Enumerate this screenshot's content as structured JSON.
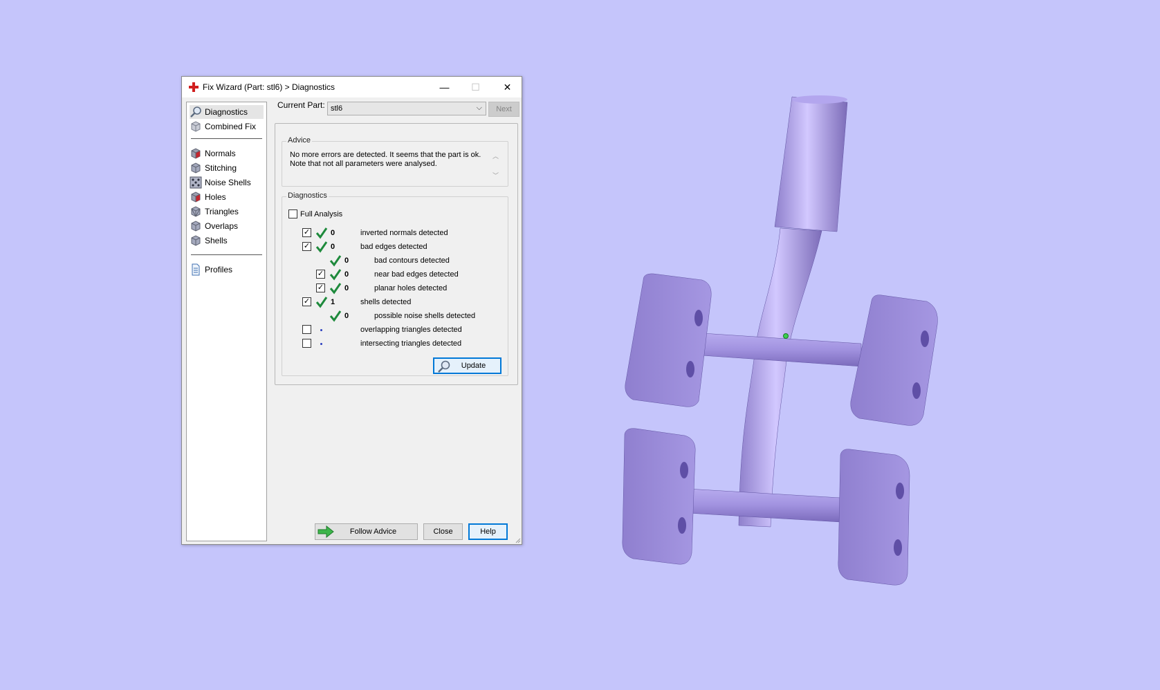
{
  "window": {
    "title": "Fix Wizard (Part: stl6) > Diagnostics",
    "controls": {
      "minimize": "—",
      "maximize": "☐",
      "close": "✕"
    }
  },
  "nav": {
    "items": [
      {
        "label": "Diagnostics",
        "icon": "magnifier-icon"
      },
      {
        "label": "Combined Fix",
        "icon": "cube-icon"
      },
      {
        "label": "Normals",
        "icon": "cube-red-icon"
      },
      {
        "label": "Stitching",
        "icon": "cube-icon"
      },
      {
        "label": "Noise Shells",
        "icon": "dice-icon"
      },
      {
        "label": "Holes",
        "icon": "cube-red-icon"
      },
      {
        "label": "Triangles",
        "icon": "cube-icon"
      },
      {
        "label": "Overlaps",
        "icon": "cube-icon"
      },
      {
        "label": "Shells",
        "icon": "cube-icon"
      },
      {
        "label": "Profiles",
        "icon": "document-icon"
      }
    ]
  },
  "current_part": {
    "label": "Current Part:",
    "value": "stl6",
    "next_label": "Next"
  },
  "advice": {
    "title": "Advice",
    "line1": "No more errors are detected. It seems that the part is ok.",
    "line2": "Note that not all parameters were analysed."
  },
  "diagnostics": {
    "title": "Diagnostics",
    "full_analysis_label": "Full Analysis",
    "rows": [
      {
        "checked": true,
        "has_checkbox": true,
        "status": "ok",
        "count": "0",
        "label": "inverted normals detected"
      },
      {
        "checked": true,
        "has_checkbox": true,
        "status": "ok",
        "count": "0",
        "label": "bad edges detected"
      },
      {
        "checked": false,
        "has_checkbox": false,
        "status": "ok",
        "count": "0",
        "label": "bad contours detected"
      },
      {
        "checked": true,
        "has_checkbox": true,
        "status": "ok",
        "count": "0",
        "label": "near bad edges detected"
      },
      {
        "checked": true,
        "has_checkbox": true,
        "status": "ok",
        "count": "0",
        "label": "planar holes detected"
      },
      {
        "checked": true,
        "has_checkbox": true,
        "status": "ok",
        "count": "1",
        "label": "shells detected"
      },
      {
        "checked": false,
        "has_checkbox": false,
        "status": "ok",
        "count": "0",
        "label": "possible noise shells detected"
      },
      {
        "checked": false,
        "has_checkbox": true,
        "status": "pending",
        "count": "",
        "label": "overlapping triangles detected"
      },
      {
        "checked": false,
        "has_checkbox": true,
        "status": "pending",
        "count": "",
        "label": "intersecting triangles detected"
      }
    ],
    "update_label": "Update"
  },
  "footer": {
    "follow_advice_label": "Follow Advice",
    "close_label": "Close",
    "help_label": "Help"
  },
  "colors": {
    "background": "#c5c5fb",
    "model_fill": "#9a8ad6",
    "check_green": "#1e8a3c"
  }
}
